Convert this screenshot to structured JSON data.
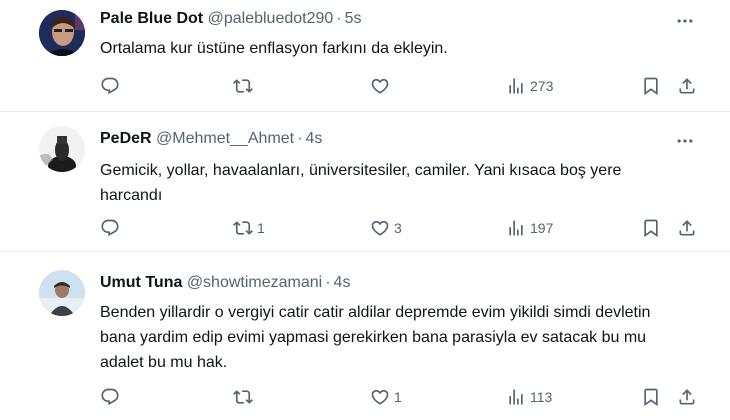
{
  "tweets": [
    {
      "name": "Pale Blue Dot",
      "handle": "@palebluedot290",
      "separator": "·",
      "time": "5s",
      "text": "Ortalama kur üstüne enflasyon farkını da ekleyin.",
      "replies": "",
      "retweets": "",
      "likes": "",
      "views": "273"
    },
    {
      "name": "PeDeR",
      "handle": "@Mehmet__Ahmet",
      "separator": "·",
      "time": "4s",
      "text": "Gemicik, yollar, havaalanları, üniversitesiler, camiler. Yani kısaca boş yere harcandı",
      "replies": "",
      "retweets": "1",
      "likes": "3",
      "views": "197"
    },
    {
      "name": "Umut Tuna",
      "handle": "@showtimezamani",
      "separator": "·",
      "time": "4s",
      "text": "Benden yillardir o vergiyi catir catir aldilar depremde evim yikildi simdi devletin bana yardim edip evimi yapmasi gerekirken bana parasiyla ev satacak bu mu adalet bu mu hak.",
      "replies": "",
      "retweets": "",
      "likes": "1",
      "views": "113"
    }
  ],
  "colors": {
    "text": "#0f1419",
    "muted": "#536471",
    "border": "#e7ebee"
  }
}
